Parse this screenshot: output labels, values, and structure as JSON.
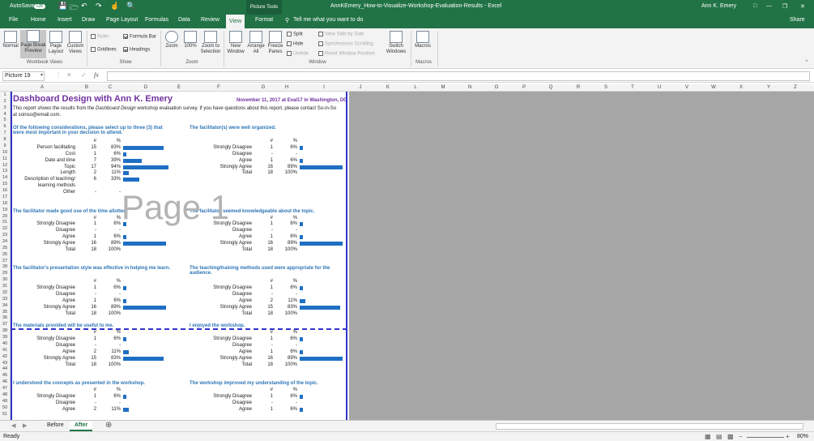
{
  "titlebar": {
    "autosave": "AutoSave",
    "autosave_state": "Off",
    "context_tab": "Picture Tools",
    "doc_title": "AnnKEmery_How-to-Visualize-Workshop-Evaluation-Results  -  Excel",
    "user": "Ann K. Emery"
  },
  "tabs": [
    "File",
    "Home",
    "Insert",
    "Draw",
    "Page Layout",
    "Formulas",
    "Data",
    "Review",
    "View",
    "Format"
  ],
  "tell_me": "Tell me what you want to do",
  "share": "Share",
  "ribbon": {
    "workbook_views": {
      "group": "Workbook Views",
      "normal": "Normal",
      "page_break": "Page Break Preview",
      "page_layout": "Page Layout",
      "custom": "Custom Views"
    },
    "show": {
      "group": "Show",
      "ruler": "Ruler",
      "formula_bar": "Formula Bar",
      "gridlines": "Gridlines",
      "headings": "Headings"
    },
    "zoom": {
      "group": "Zoom",
      "zoom": "Zoom",
      "hundred": "100%",
      "zoom_sel": "Zoom to Selection"
    },
    "window": {
      "group": "Window",
      "new": "New Window",
      "arrange": "Arrange All",
      "freeze": "Freeze Panes",
      "split": "Split",
      "hide": "Hide",
      "unhide": "Unhide",
      "side": "View Side by Side",
      "sync": "Synchronous Scrolling",
      "reset": "Reset Window Position",
      "switch": "Switch Windows"
    },
    "macros": {
      "group": "Macros",
      "macros": "Macros"
    }
  },
  "namebox": "Picture 19",
  "columns": [
    "A",
    "B",
    "C",
    "D",
    "E",
    "F",
    "G",
    "H",
    "I",
    "J",
    "K",
    "L",
    "M",
    "N",
    "O",
    "P",
    "Q",
    "R",
    "S",
    "T",
    "U",
    "V",
    "W",
    "X",
    "Y",
    "Z"
  ],
  "rows": [
    "1",
    "2",
    "3",
    "4",
    "5",
    "6",
    "7",
    "8",
    "9",
    "10",
    "11",
    "12",
    "13",
    "14",
    "15",
    "16",
    "17",
    "18",
    "19",
    "20",
    "21",
    "22",
    "23",
    "24",
    "25",
    "26",
    "27",
    "28",
    "29",
    "30",
    "31",
    "32",
    "33",
    "34",
    "35",
    "36",
    "37",
    "38",
    "39",
    "40",
    "41",
    "42",
    "43",
    "44",
    "45",
    "46",
    "47",
    "48",
    "49",
    "50",
    "51"
  ],
  "sheet": {
    "title": "Dashboard Design with Ann K. Emery",
    "date": "November 11, 2017 at Eval17 in Washington, DC",
    "intro1": "This report shows the results from the ",
    "intro_it": "Dashboard Design",
    "intro2": " workshop evaluation survey. If you have questions about this report, please contact So-in-So",
    "intro3": "at soinso@email.com.",
    "hash": "#",
    "pct": "%",
    "total": "Total",
    "watermark": "Page 1"
  },
  "q1": {
    "title": "Of the following considerations, please select up to three (3) that were most important in your decision to attend.",
    "rows": [
      {
        "label": "Person facilitating",
        "n": "15",
        "p": "83%",
        "v": 0.83
      },
      {
        "label": "Cost",
        "n": "1",
        "p": "6%",
        "v": 0.06
      },
      {
        "label": "Date and time",
        "n": "7",
        "p": "39%",
        "v": 0.39
      },
      {
        "label": "Topic",
        "n": "17",
        "p": "94%",
        "v": 0.94
      },
      {
        "label": "Length",
        "n": "2",
        "p": "11%",
        "v": 0.11
      },
      {
        "label": "Description of teaching/",
        "n": "6",
        "p": "33%",
        "v": 0.33
      },
      {
        "label": "learning methods",
        "n": "",
        "p": "",
        "v": 0
      },
      {
        "label": "Other",
        "n": "-",
        "p": "-",
        "v": 0
      }
    ]
  },
  "q2": {
    "title": "The facilitator(s) were well organized.",
    "rows": [
      {
        "label": "Strongly Disagree",
        "n": "1",
        "p": "6%",
        "v": 0.06
      },
      {
        "label": "Disagree",
        "n": "-",
        "p": "-",
        "v": 0
      },
      {
        "label": "Agree",
        "n": "1",
        "p": "6%",
        "v": 0.06
      },
      {
        "label": "Strongly Agree",
        "n": "16",
        "p": "89%",
        "v": 0.89
      }
    ],
    "total_n": "18",
    "total_p": "100%"
  },
  "q3": {
    "title": "The facilitator made good use of the time allotted.",
    "rows": [
      {
        "label": "Strongly Disagree",
        "n": "1",
        "p": "6%",
        "v": 0.06
      },
      {
        "label": "Disagree",
        "n": "-",
        "p": "-",
        "v": 0
      },
      {
        "label": "Agree",
        "n": "1",
        "p": "6%",
        "v": 0.06
      },
      {
        "label": "Strongly Agree",
        "n": "16",
        "p": "89%",
        "v": 0.89
      }
    ],
    "total_n": "18",
    "total_p": "100%"
  },
  "q4": {
    "title": "The facilitator seemed knowledgeable about the topic.",
    "rows": [
      {
        "label": "Strongly Disagree",
        "n": "1",
        "p": "6%",
        "v": 0.06
      },
      {
        "label": "Disagree",
        "n": "-",
        "p": "-",
        "v": 0
      },
      {
        "label": "Agree",
        "n": "1",
        "p": "6%",
        "v": 0.06
      },
      {
        "label": "Strongly Agree",
        "n": "16",
        "p": "89%",
        "v": 0.89
      }
    ],
    "total_n": "18",
    "total_p": "100%"
  },
  "q5": {
    "title": "The facilitator's presentation style was effective in helping me learn.",
    "rows": [
      {
        "label": "Strongly Disagree",
        "n": "1",
        "p": "6%",
        "v": 0.06
      },
      {
        "label": "Disagree",
        "n": "-",
        "p": "-",
        "v": 0
      },
      {
        "label": "Agree",
        "n": "1",
        "p": "6%",
        "v": 0.06
      },
      {
        "label": "Strongly Agree",
        "n": "16",
        "p": "89%",
        "v": 0.89
      }
    ],
    "total_n": "18",
    "total_p": "100%"
  },
  "q6": {
    "title": "The teaching/training methods used were appropriate for the audience.",
    "rows": [
      {
        "label": "Strongly Disagree",
        "n": "1",
        "p": "6%",
        "v": 0.06
      },
      {
        "label": "Disagree",
        "n": "-",
        "p": "-",
        "v": 0
      },
      {
        "label": "Agree",
        "n": "2",
        "p": "11%",
        "v": 0.11
      },
      {
        "label": "Strongly Agree",
        "n": "15",
        "p": "83%",
        "v": 0.83
      }
    ],
    "total_n": "18",
    "total_p": "100%"
  },
  "q7": {
    "title": "The materials provided will be useful to me.",
    "rows": [
      {
        "label": "Strongly Disagree",
        "n": "1",
        "p": "6%",
        "v": 0.06
      },
      {
        "label": "Disagree",
        "n": "-",
        "p": "-",
        "v": 0
      },
      {
        "label": "Agree",
        "n": "2",
        "p": "11%",
        "v": 0.11
      },
      {
        "label": "Strongly Agree",
        "n": "15",
        "p": "83%",
        "v": 0.83
      }
    ],
    "total_n": "18",
    "total_p": "100%"
  },
  "q8": {
    "title": "I enjoyed the workshop.",
    "rows": [
      {
        "label": "Strongly Disagree",
        "n": "1",
        "p": "6%",
        "v": 0.06
      },
      {
        "label": "Disagree",
        "n": "-",
        "p": "-",
        "v": 0
      },
      {
        "label": "Agree",
        "n": "1",
        "p": "6%",
        "v": 0.06
      },
      {
        "label": "Strongly Agree",
        "n": "16",
        "p": "89%",
        "v": 0.89
      }
    ],
    "total_n": "18",
    "total_p": "100%"
  },
  "q9": {
    "title": "I understood the concepts as presented in the workshop.",
    "rows": [
      {
        "label": "Strongly Disagree",
        "n": "1",
        "p": "6%",
        "v": 0.06
      },
      {
        "label": "Disagree",
        "n": "-",
        "p": "-",
        "v": 0
      },
      {
        "label": "Agree",
        "n": "2",
        "p": "11%",
        "v": 0.11
      }
    ]
  },
  "q10": {
    "title": "The workshop improved my understanding of the topic.",
    "rows": [
      {
        "label": "Strongly Disagree",
        "n": "1",
        "p": "6%",
        "v": 0.06
      },
      {
        "label": "Disagree",
        "n": "-",
        "p": "-",
        "v": 0
      },
      {
        "label": "Agree",
        "n": "1",
        "p": "6%",
        "v": 0.06
      }
    ]
  },
  "sheets": [
    "Before",
    "After"
  ],
  "status": {
    "ready": "Ready",
    "zoom": "80%"
  },
  "colors": {
    "excel_green": "#217346",
    "title_purple": "#7030a0",
    "question_blue": "#2e75b6",
    "bar_blue": "#1f6fc4",
    "page_border": "#3333cc"
  }
}
